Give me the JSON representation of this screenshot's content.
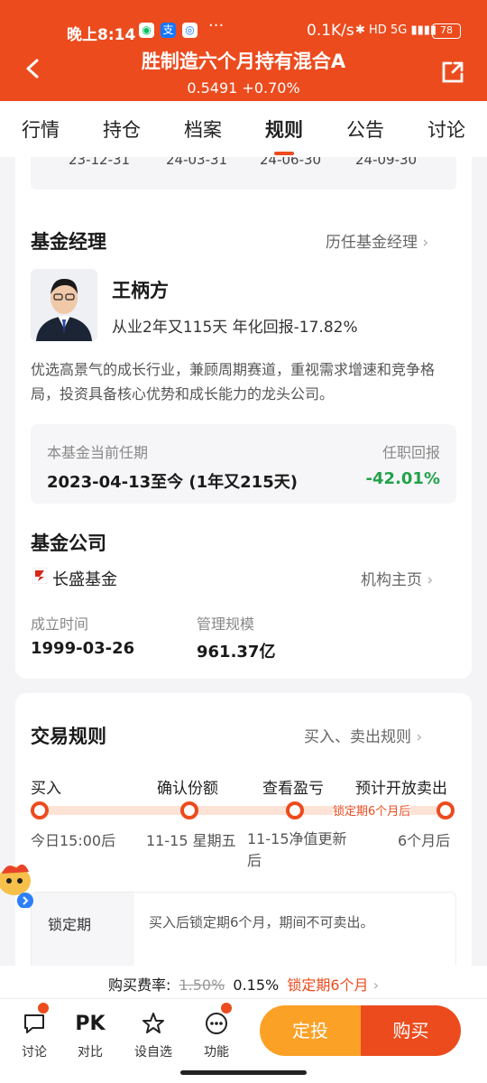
{
  "status_bar": {
    "time": "晚上8:14",
    "net_speed": "0.1K/s",
    "signal": "5G",
    "battery": "78"
  },
  "header": {
    "title": "胜制造六个月持有混合A",
    "price": "0.5491",
    "change": "+0.70%"
  },
  "tabs": [
    "行情",
    "持仓",
    "档案",
    "规则",
    "公告",
    "讨论"
  ],
  "active_tab": 3,
  "dates": [
    "23-12-31",
    "24-03-31",
    "24-06-30",
    "24-09-30"
  ],
  "manager": {
    "section_title": "基金经理",
    "link": "历任基金经理",
    "name": "王柄方",
    "info": "从业2年又115天 年化回报-17.82%",
    "desc": "优选高景气的成长行业，兼顾周期赛道，重视需求增速和竞争格局，投资具备核心优势和成长能力的龙头公司。",
    "tenure_label": "本基金当前任期",
    "tenure_value": "2023-04-13至今 (1年又215天)",
    "return_label": "任职回报",
    "return_value": "-42.01%"
  },
  "company": {
    "section_title": "基金公司",
    "name": "长盛基金",
    "link": "机构主页",
    "founded_label": "成立时间",
    "founded_value": "1999-03-26",
    "aum_label": "管理规模",
    "aum_value": "961.37亿"
  },
  "trade": {
    "section_title": "交易规则",
    "link": "买入、卖出规则",
    "stages": [
      "买入",
      "确认份额",
      "查看盈亏",
      "预计开放卖出"
    ],
    "stage_subs": [
      "今日15:00后",
      "11-15 星期五",
      "11-15净值更新后",
      "6个月后"
    ],
    "lock_tag": "锁定期6个月后",
    "lock_key": "锁定期",
    "lock_value": "买入后锁定期6个月，期间不可卖出。"
  },
  "fee": {
    "label": "购买费率:",
    "old": "1.50%",
    "new": "0.15%",
    "lock": "锁定期6个月"
  },
  "bottom_nav": [
    "讨论",
    "对比",
    "设自选",
    "功能"
  ],
  "pk_text": "PK",
  "buttons": {
    "fixed": "定投",
    "buy": "购买"
  },
  "colors": {
    "brand": "#ec4b1e",
    "positive": "#22a34a",
    "accent": "#fba126"
  }
}
